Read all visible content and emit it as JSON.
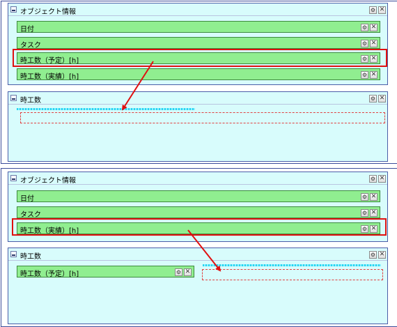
{
  "object_panel": {
    "title": "オブジェクト情報"
  },
  "hours_panel": {
    "title": "時工数"
  },
  "fields": {
    "date": "日付",
    "task": "タスク",
    "planned_hours": "時工数（予定）[h]",
    "actual_hours": "時工数（実績）[h]"
  },
  "icons": {
    "minimize": "minimize-icon",
    "gear": "gear-icon",
    "close": "close-icon",
    "arrow": "red-arrow-icon"
  },
  "glyphs": {
    "gear": "⚙",
    "close": "✕"
  },
  "colors": {
    "field_fill": "#90ee90",
    "field_border": "#3d8a3d",
    "panel_fill": "#d8fcfc",
    "panel_border": "#4a5da8",
    "highlight": "#e01010",
    "drop_indicator": "#28d4f0"
  }
}
